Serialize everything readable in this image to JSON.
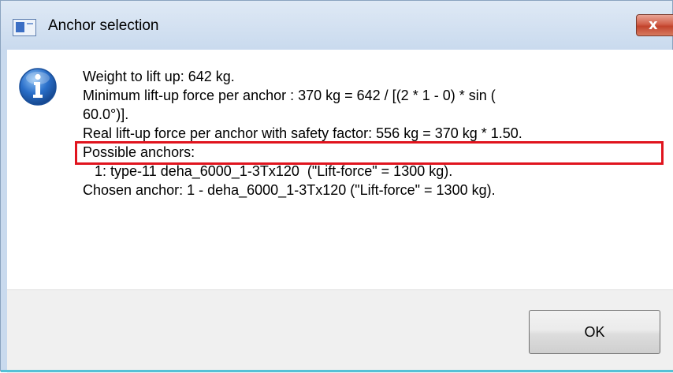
{
  "window": {
    "title": "Anchor selection",
    "close_label": "x"
  },
  "message": {
    "lines": [
      "Weight to lift up: 642 kg.",
      "Minimum lift-up force per anchor : 370 kg = 642 / [(2 * 1 - 0) * sin (",
      "60.0°)].",
      "Real lift-up force per anchor with safety factor: 556 kg = 370 kg * 1.50.",
      "Possible anchors:",
      "   1: type-11 deha_6000_1-3Tx120  (\"Lift-force\" = 1300 kg).",
      "Chosen anchor: 1 - deha_6000_1-3Tx120 (\"Lift-force\" = 1300 kg)."
    ]
  },
  "buttons": {
    "ok_label": "OK"
  },
  "icons": {
    "app": "app-window-icon",
    "info": "information-icon",
    "close": "close-icon"
  },
  "colors": {
    "highlight_border": "#e0141e",
    "close_button": "#c2432d",
    "info_icon": "#2a6fc9"
  }
}
